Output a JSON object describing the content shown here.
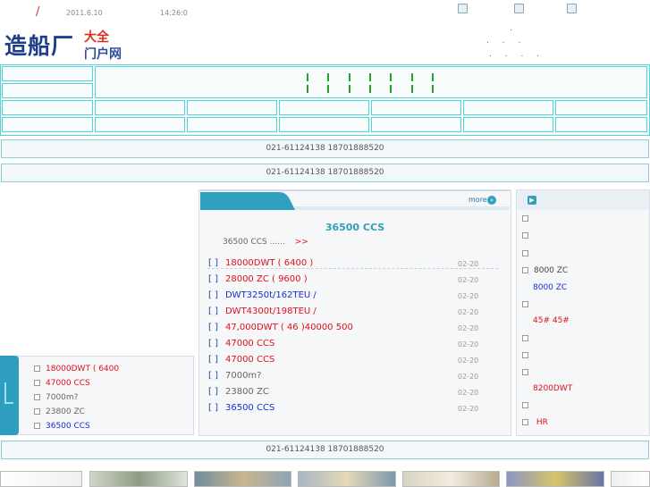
{
  "topbar": {
    "slash": "/",
    "date": "2011.6.10",
    "time": "14:26:0"
  },
  "logo": {
    "big": "造船厂",
    "small_top": "大全",
    "small_bottom": "门户网"
  },
  "header_dots": {
    "line1": ".",
    "line2": ". . .",
    "line3": ". . . ."
  },
  "phone_bars": [
    "021-61124138 18701888520",
    "021-61124138 18701888520",
    "021-61124138 18701888520"
  ],
  "middle": {
    "more_label": "more",
    "headline": "36500     CCS",
    "summary": "36500   CCS  ......",
    "summary_link": ">>",
    "rows": [
      {
        "bracket": "[    ]",
        "text": "18000DWT   ( 6400 )",
        "date": "02-20",
        "color": "#e0101a"
      },
      {
        "bracket": "[    ]",
        "text": "28000 ZC   ( 9600 )",
        "date": "02-20",
        "color": "#e0101a"
      },
      {
        "bracket": "[    ]",
        "text": "DWT3250t/162TEU   /",
        "date": "02-20",
        "color": "#1a2fd0"
      },
      {
        "bracket": "[    ]",
        "text": "DWT4300t/198TEU   /",
        "date": "02-20",
        "color": "#e0101a"
      },
      {
        "bracket": "[    ]",
        "text": "47,000DWT    ( 46 )40000 500",
        "date": "02-20",
        "color": "#e0101a"
      },
      {
        "bracket": "[    ]",
        "text": "47000     CCS",
        "date": "02-20",
        "color": "#e0101a"
      },
      {
        "bracket": "[    ]",
        "text": "47000     CCS",
        "date": "02-20",
        "color": "#e0101a"
      },
      {
        "bracket": "[    ]",
        "text": "7000m?",
        "date": "02-20",
        "color": "#666666"
      },
      {
        "bracket": "[    ]",
        "text": "23800     ZC",
        "date": "02-20",
        "color": "#666666"
      },
      {
        "bracket": "[    ]",
        "text": "36500     CCS",
        "date": "02-20",
        "color": "#1a2fd0"
      }
    ]
  },
  "left_list": [
    {
      "text": "18000DWT     ( 6400",
      "color": "#e0101a"
    },
    {
      "text": "47000     CCS",
      "color": "#e0101a"
    },
    {
      "text": "7000m?",
      "color": "#666666"
    },
    {
      "text": "23800     ZC",
      "color": "#666666"
    },
    {
      "text": "36500     CCS",
      "color": "#1a2fd0"
    }
  ],
  "right_list": [
    {
      "text": "",
      "color": "#666666"
    },
    {
      "text": "",
      "color": "#666666"
    },
    {
      "text": "",
      "color": "#666666"
    },
    {
      "text": "8000 ZC",
      "color": "#1a2fd0"
    },
    {
      "text": "",
      "color": "#666666"
    },
    {
      "text": "45#   45#",
      "color": "#e0101a"
    },
    {
      "text": "",
      "color": "#666666"
    },
    {
      "text": "",
      "color": "#666666"
    },
    {
      "text": "   8200DWT",
      "color": "#e0101a"
    },
    {
      "text": "",
      "color": "#666666"
    },
    {
      "text": "  HR",
      "color": "#e0101a"
    }
  ]
}
